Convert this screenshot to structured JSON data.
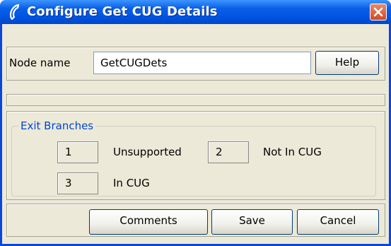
{
  "window": {
    "title": "Configure Get CUG Details",
    "icon": "phone-handset-icon",
    "close_icon": "close-icon"
  },
  "node": {
    "label": "Node name",
    "value": "GetCUGDets",
    "help_label": "Help"
  },
  "exit_branches": {
    "legend": "Exit Branches",
    "items": [
      {
        "number": "1",
        "label": "Unsupported"
      },
      {
        "number": "2",
        "label": "Not In CUG"
      },
      {
        "number": "3",
        "label": "In CUG"
      }
    ]
  },
  "buttons": {
    "comments": "Comments",
    "save": "Save",
    "cancel": "Cancel"
  },
  "colors": {
    "titlebar": "#0054E3",
    "background": "#ECE9D8",
    "legend_text": "#0046D5",
    "close_button": "#D24A22"
  }
}
